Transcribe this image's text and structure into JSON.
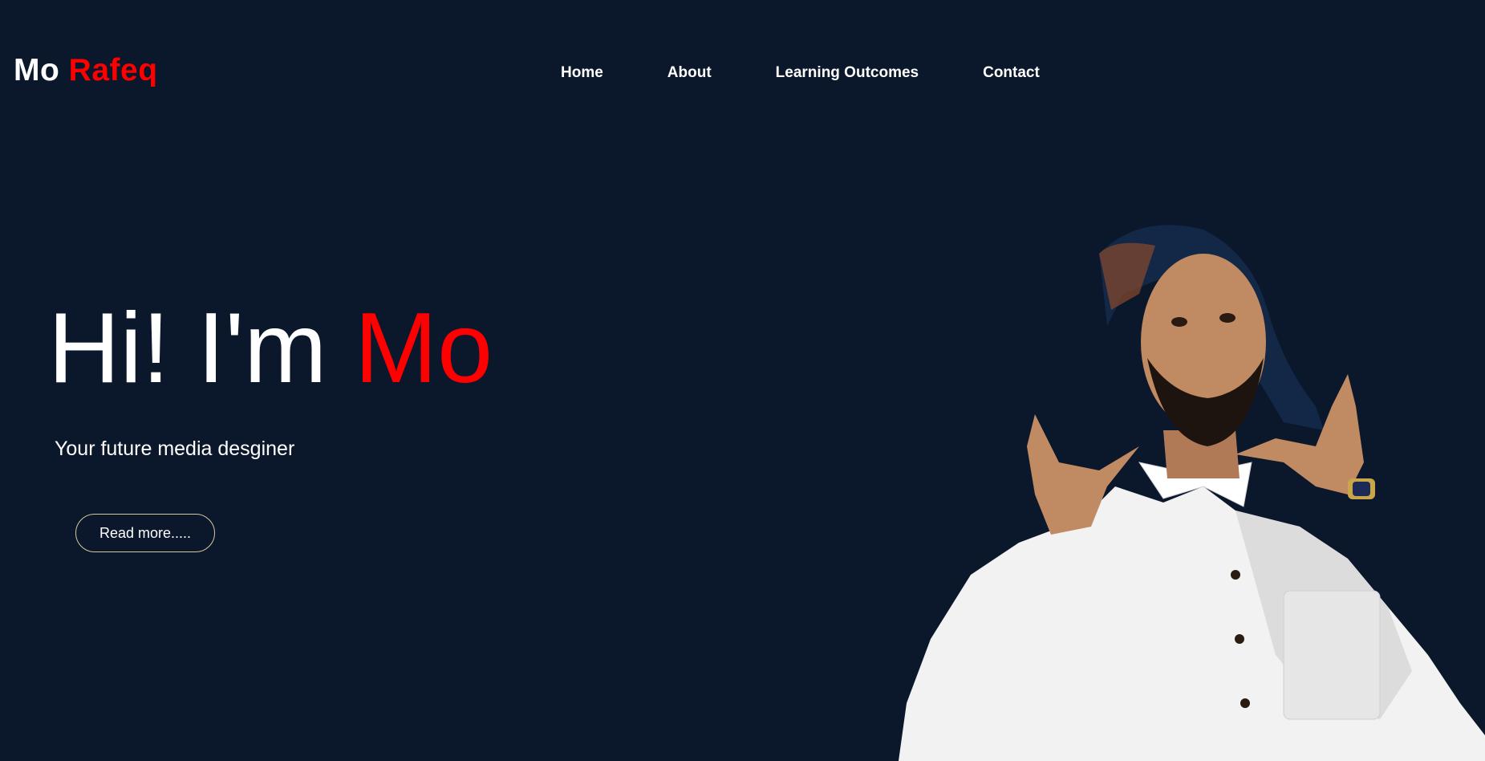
{
  "logo": {
    "first": "Mo",
    "last": "Rafeq"
  },
  "nav": {
    "items": [
      "Home",
      "About",
      "Learning Outcomes",
      "Contact"
    ]
  },
  "hero": {
    "greeting": "Hi! I'm",
    "name": "Mo",
    "subtitle": "Your future media desginer",
    "cta_label": "Read more.....",
    "portrait_description": ""
  },
  "colors": {
    "background": "#0b172b",
    "accent": "#ff0000",
    "text": "#ffffff",
    "button_border": "#d7c7a2"
  }
}
